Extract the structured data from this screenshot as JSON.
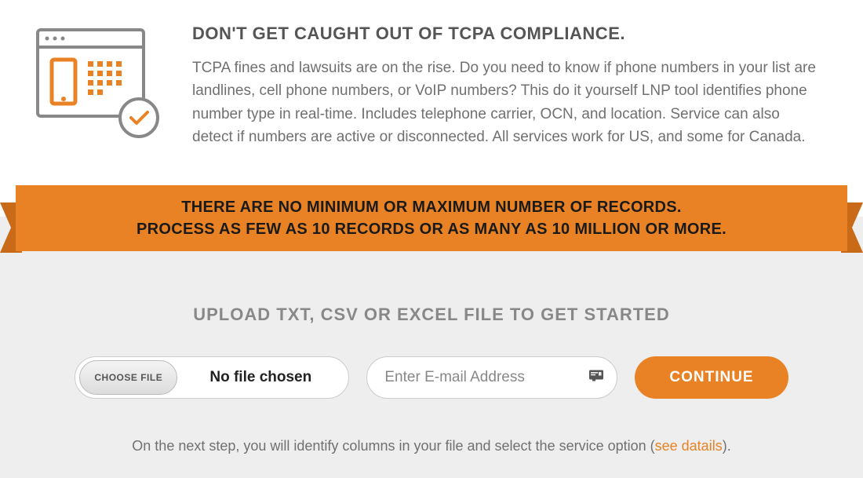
{
  "hero": {
    "title": "DON'T GET CAUGHT OUT OF TCPA COMPLIANCE.",
    "paragraph": "TCPA fines and lawsuits are on the rise. Do you need to know if phone numbers in your list are landlines, cell phone numbers, or VoIP numbers? This do it yourself LNP tool identifies phone number type in real-time. Includes telephone carrier, OCN, and location. Service can also detect if numbers are active or disconnected. All services work for US, and some for Canada."
  },
  "ribbon": {
    "line1": "THERE ARE NO MINIMUM OR MAXIMUM NUMBER OF RECORDS.",
    "line2": "PROCESS AS FEW AS 10 RECORDS OR AS MANY AS 10 MILLION OR MORE."
  },
  "upload": {
    "title": "UPLOAD TXT, CSV OR EXCEL FILE TO GET STARTED",
    "choose_label": "CHOOSE FILE",
    "file_status": "No file chosen",
    "email_placeholder": "Enter E-mail Address",
    "continue_label": "CONTINUE",
    "hint_prefix": "On the next step, you will identify columns in your file and select the service option (",
    "hint_link": "see datails",
    "hint_suffix": ")."
  }
}
